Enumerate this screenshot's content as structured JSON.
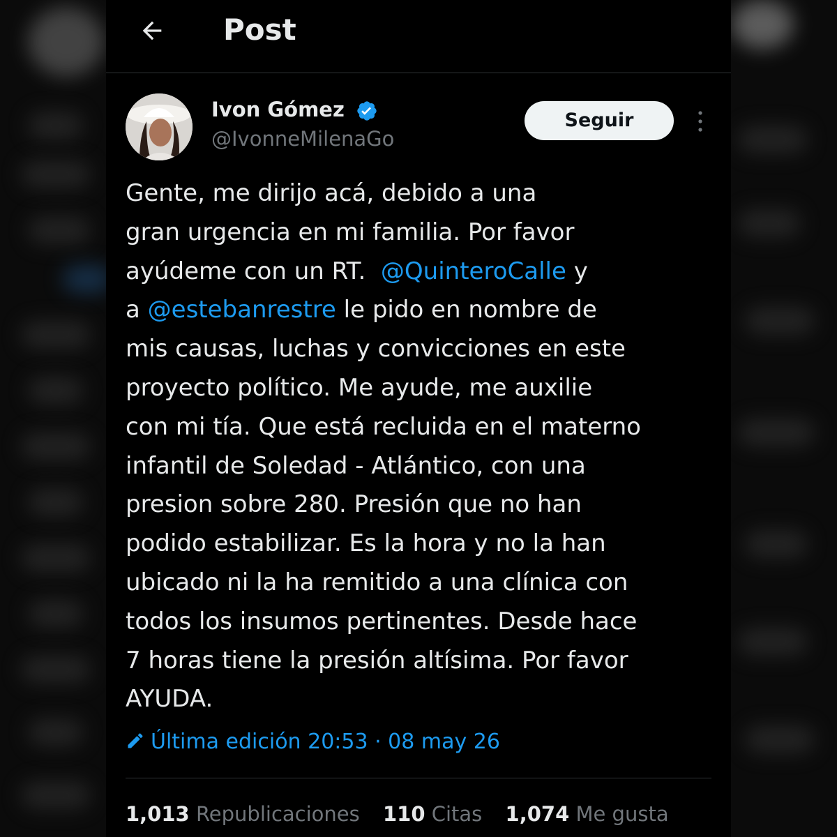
{
  "header": {
    "title": "Post",
    "back_icon": "arrow-left-icon"
  },
  "author": {
    "name": "Ivon Gómez",
    "handle": "@IvonneMilenaGo",
    "verified_icon": "verified-badge-icon",
    "follow_label": "Seguir",
    "more_icon": "more-vertical-icon"
  },
  "post": {
    "lines": [
      "Gente, me dirijo acá, debido a una",
      "gran urgencia en mi familia. Por favor",
      "ayúdeme con un RT.  ",
      "@QuinteroCalle",
      " y",
      "a ",
      "@estebanrestre",
      " le pido en nombre de",
      "mis causas, luchas y convicciones en este",
      "proyecto político. Me ayude, me auxilie",
      "con mi tía. Que está recluida en el materno",
      "infantil de Soledad - Atlántico, con una",
      "presion sobre 280. Presión que no han",
      "podido estabilizar. Es la hora y no la han",
      "ubicado ni la ha remitido a una clínica con",
      "todos los insumos pertinentes. Desde hace",
      "7 horas tiene la presión altísima. Por favor",
      "AYUDA."
    ],
    "edit_info": "Última edición 20:53 · 08 may 26",
    "edit_icon": "pencil-icon"
  },
  "stats": [
    {
      "count": "1,013",
      "label": "Republicaciones"
    },
    {
      "count": "110",
      "label": "Citas"
    },
    {
      "count": "1,074",
      "label": "Me gusta"
    }
  ],
  "colors": {
    "accent": "#1d9bf0",
    "background": "#000000",
    "text": "#e7e9ea",
    "secondary_text": "#71767b"
  }
}
